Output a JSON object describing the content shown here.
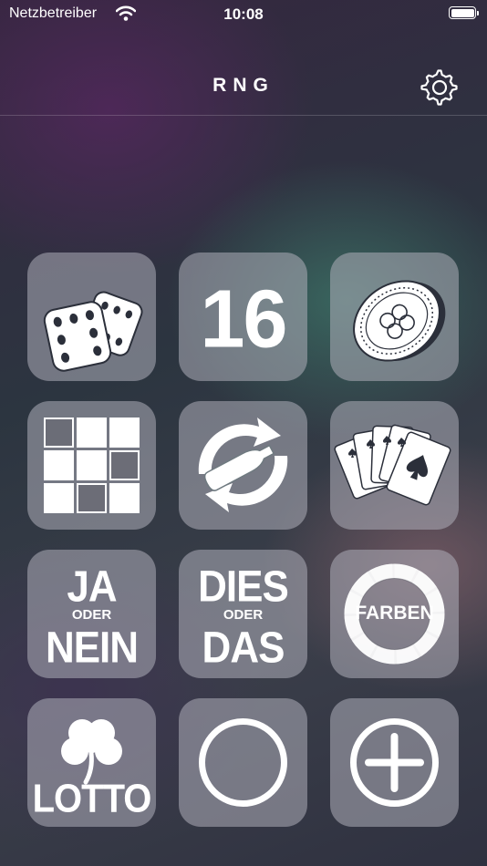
{
  "status_bar": {
    "carrier": "Netzbetreiber",
    "time": "10:08"
  },
  "nav": {
    "title": "RNG"
  },
  "tiles": {
    "number": {
      "label": "16"
    },
    "yes_no": {
      "line1": "JA",
      "line2": "ODER",
      "line3": "NEIN"
    },
    "this_that": {
      "line1": "DIES",
      "line2": "ODER",
      "line3": "DAS"
    },
    "colors": {
      "label": "FARBEN"
    },
    "lotto": {
      "label": "LOTTO"
    }
  },
  "colors": {
    "tile_background": "#a8a8b4",
    "icon": "#ffffff"
  }
}
